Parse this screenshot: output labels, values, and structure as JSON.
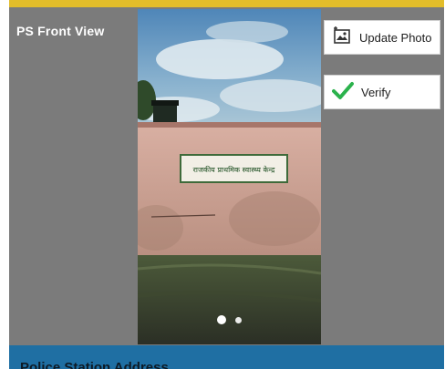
{
  "header": {
    "title": "PS Front View",
    "accent_color": "#e3bd2a"
  },
  "actions": {
    "update_photo_label": "Update Photo",
    "update_photo_icon": "image-upload-icon",
    "verify_label": "Verify",
    "verify_icon": "check-icon",
    "verify_color": "#2bb24c"
  },
  "photo": {
    "signboard_text": "राजकीय प्राथमिक स्वास्थ्य केन्द्र",
    "carousel_total": 2,
    "carousel_active": 1
  },
  "footer": {
    "label": "Police Station Address",
    "bar_color": "#1f6fa3"
  }
}
